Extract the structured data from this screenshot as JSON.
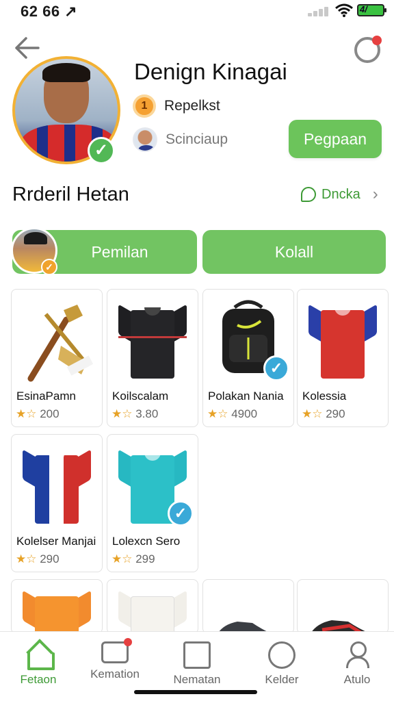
{
  "status_bar": {
    "time": "62 66 ↗",
    "battery_label": "4/"
  },
  "header": {
    "username": "Denign Kinagai",
    "rank_badge": "1",
    "rank_text": "Repelkst",
    "sub_text": "Scinciaup",
    "follow_button": "Pegpaan"
  },
  "section": {
    "title": "Rrderil Hetan",
    "link_label": "Dncka",
    "chevron": "›"
  },
  "segments": {
    "left": "Pemilan",
    "right": "Kolall"
  },
  "stars": "★☆",
  "products": [
    {
      "name": "EsinaPamn",
      "rating": "200",
      "icon": "golden-club-icon",
      "checked": false
    },
    {
      "name": "Koilscalam",
      "rating": "3.80",
      "icon": "black-jacket-icon",
      "checked": false
    },
    {
      "name": "Polakan Nania",
      "rating": "4900",
      "icon": "backpack-icon",
      "checked": true
    },
    {
      "name": "Kolessia",
      "rating": "290",
      "icon": "red-jersey-icon",
      "checked": false
    },
    {
      "name": "Kolelser Manjai",
      "rating": "290",
      "icon": "striped-jersey-icon",
      "checked": false
    },
    {
      "name": "Lolexcn Sero",
      "rating": "299",
      "icon": "teal-jersey-icon",
      "checked": true
    }
  ],
  "partial_products": [
    {
      "icon": "orange-jersey-icon"
    },
    {
      "icon": "white-jersey-icon"
    },
    {
      "icon": "grey-sneaker-icon"
    },
    {
      "icon": "red-black-sneaker-icon"
    }
  ],
  "tabs": [
    {
      "label": "Fetaon",
      "icon": "home-icon",
      "active": true
    },
    {
      "label": "Kemation",
      "icon": "chat-icon",
      "active": false
    },
    {
      "label": "Nematan",
      "icon": "box-icon",
      "active": false
    },
    {
      "label": "Kelder",
      "icon": "dial-icon",
      "active": false
    },
    {
      "label": "Atulo",
      "icon": "user-icon",
      "active": false
    }
  ]
}
